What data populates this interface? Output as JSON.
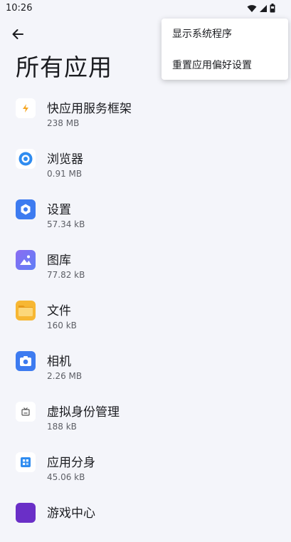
{
  "status_bar": {
    "time": "10:26",
    "icons": [
      "wifi-icon",
      "signal-icon",
      "battery-icon"
    ]
  },
  "header": {
    "back_icon": "arrow-left-icon",
    "title": "所有应用"
  },
  "menu": {
    "items": [
      "显示系统程序",
      "重置应用偏好设置"
    ]
  },
  "apps": [
    {
      "name": "快应用服务框架",
      "size": "238 MB",
      "icon": "quick-app-icon"
    },
    {
      "name": "浏览器",
      "size": "0.91 MB",
      "icon": "browser-icon"
    },
    {
      "name": "设置",
      "size": "57.34 kB",
      "icon": "settings-gear-icon"
    },
    {
      "name": "图库",
      "size": "77.82 kB",
      "icon": "gallery-icon"
    },
    {
      "name": "文件",
      "size": "160 kB",
      "icon": "folder-icon"
    },
    {
      "name": "相机",
      "size": "2.26 MB",
      "icon": "camera-icon"
    },
    {
      "name": "虚拟身份管理",
      "size": "188 kB",
      "icon": "virtual-identity-icon"
    },
    {
      "name": "应用分身",
      "size": "45.06 kB",
      "icon": "app-clone-icon"
    },
    {
      "name": "游戏中心",
      "size": "",
      "icon": "game-center-icon"
    }
  ],
  "colors": {
    "background": "#f4f5fa",
    "menu_bg": "#ffffff",
    "accent_blue": "#3d7bf0"
  }
}
